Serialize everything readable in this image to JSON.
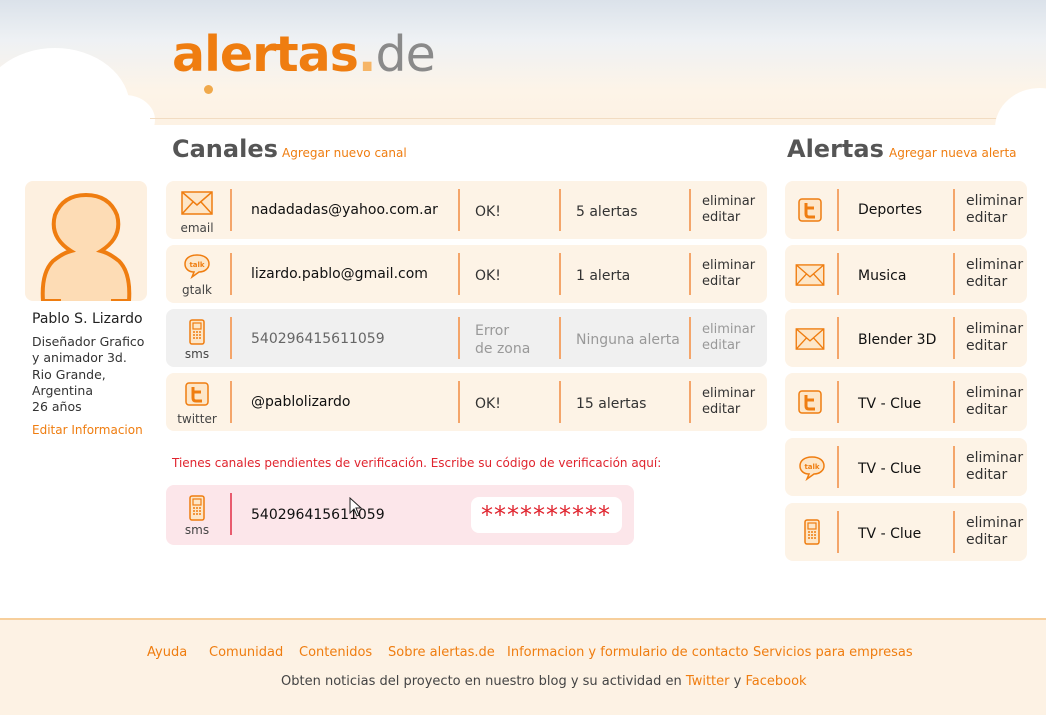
{
  "logo": {
    "part1": "alertas",
    "dot": ".",
    "part2": "de"
  },
  "channels": {
    "title": "Canales",
    "add_link": "Agregar nuevo canal",
    "rows": [
      {
        "icon": "mail-icon",
        "type": "email",
        "address": "nadadadas@yahoo.com.ar",
        "status": "OK!",
        "alerts": "5 alertas",
        "delete": "eliminar",
        "edit": "editar"
      },
      {
        "icon": "gtalk-icon",
        "type": "gtalk",
        "address": "lizardo.pablo@gmail.com",
        "status": "OK!",
        "alerts": "1 alerta",
        "delete": "eliminar",
        "edit": "editar"
      },
      {
        "icon": "phone-icon",
        "type": "sms",
        "address": "540296415611059",
        "status_line1": "Error",
        "status_line2": "de zona",
        "alerts": "Ninguna alerta",
        "delete": "eliminar",
        "edit": "editar"
      },
      {
        "icon": "twitter-icon",
        "type": "twitter",
        "address": "@pablolizardo",
        "status": "OK!",
        "alerts": "15 alertas",
        "delete": "eliminar",
        "edit": "editar"
      }
    ]
  },
  "pending": {
    "note": "Tienes canales pendientes de verificación. Escribe su código de verificación aquí:",
    "type": "sms",
    "number": "540296415611059",
    "code_value": "**********"
  },
  "profile": {
    "name": "Pablo S. Lizardo",
    "line1": "Diseñador Grafico",
    "line2": "y animador 3d.",
    "line3": "Rio Grande,",
    "line4": "Argentina",
    "line5": "26 años",
    "edit_link": "Editar Informacion"
  },
  "alerts": {
    "title": "Alertas",
    "add_link": "Agregar nueva alerta",
    "rows": [
      {
        "icon": "twitter-icon",
        "name": "Deportes",
        "delete": "eliminar",
        "edit": "editar"
      },
      {
        "icon": "mail-icon",
        "name": "Musica",
        "delete": "eliminar",
        "edit": "editar"
      },
      {
        "icon": "mail-icon",
        "name": "Blender 3D",
        "delete": "eliminar",
        "edit": "editar"
      },
      {
        "icon": "twitter-icon",
        "name": "TV - Clue",
        "delete": "eliminar",
        "edit": "editar"
      },
      {
        "icon": "gtalk-icon",
        "name": "TV - Clue",
        "delete": "eliminar",
        "edit": "editar"
      },
      {
        "icon": "phone-icon",
        "name": "TV - Clue",
        "delete": "eliminar",
        "edit": "editar"
      }
    ]
  },
  "footer": {
    "links": [
      "Ayuda",
      "Comunidad",
      "Contenidos",
      "Sobre alertas.de",
      "Informacion y formulario de contacto",
      "Servicios para empresas"
    ],
    "text_before": "Obten noticias del proyecto en nuestro blog y su actividad en",
    "twitter": "Twitter",
    "and": "y",
    "facebook": "Facebook"
  },
  "colors": {
    "accent": "#ef7d10",
    "error": "#e0242e",
    "row_bg": "#fdf3e6"
  }
}
